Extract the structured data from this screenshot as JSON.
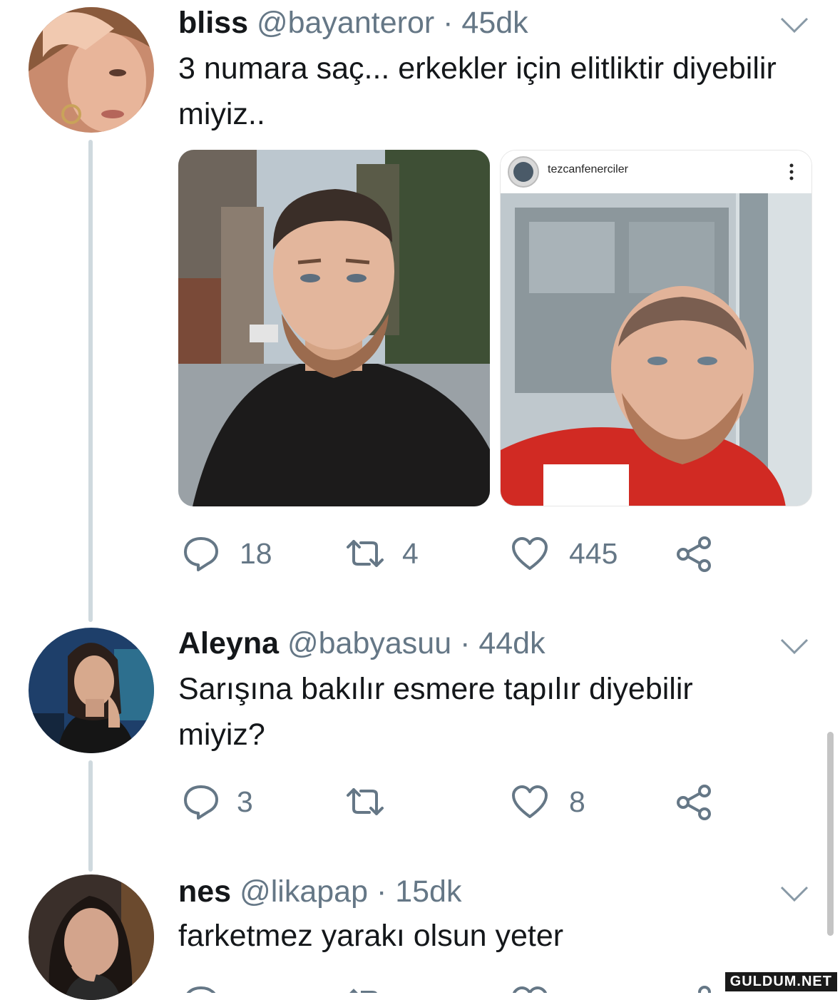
{
  "tweets": [
    {
      "name": "bliss",
      "handle": "@bayanteror",
      "sep": "·",
      "time": "45dk",
      "text": "3 numara saç... erkekler için elitliktir diyebilir miyiz..",
      "media": {
        "instagram_user": "tezcanfenerciler"
      },
      "counts": {
        "reply": "18",
        "retweet": "4",
        "like": "445"
      }
    },
    {
      "name": "Aleyna",
      "handle": "@babyasuu",
      "sep": "·",
      "time": "44dk",
      "text": "Sarışına bakılır esmere tapılır diyebilir miyiz?",
      "counts": {
        "reply": "3",
        "retweet": "",
        "like": "8"
      }
    },
    {
      "name": "nes",
      "handle": "@likapap",
      "sep": "·",
      "time": "15dk",
      "text": "farketmez yarakı olsun yeter"
    }
  ],
  "icons": {
    "reply": "reply-bubble-icon",
    "retweet": "retweet-icon",
    "like": "heart-icon",
    "share": "share-icon",
    "more": "chevron-down-icon"
  },
  "colors": {
    "text": "#14171a",
    "secondary": "#657786",
    "thread_line": "#cfd9de"
  },
  "watermark": "GULDUM.NET"
}
